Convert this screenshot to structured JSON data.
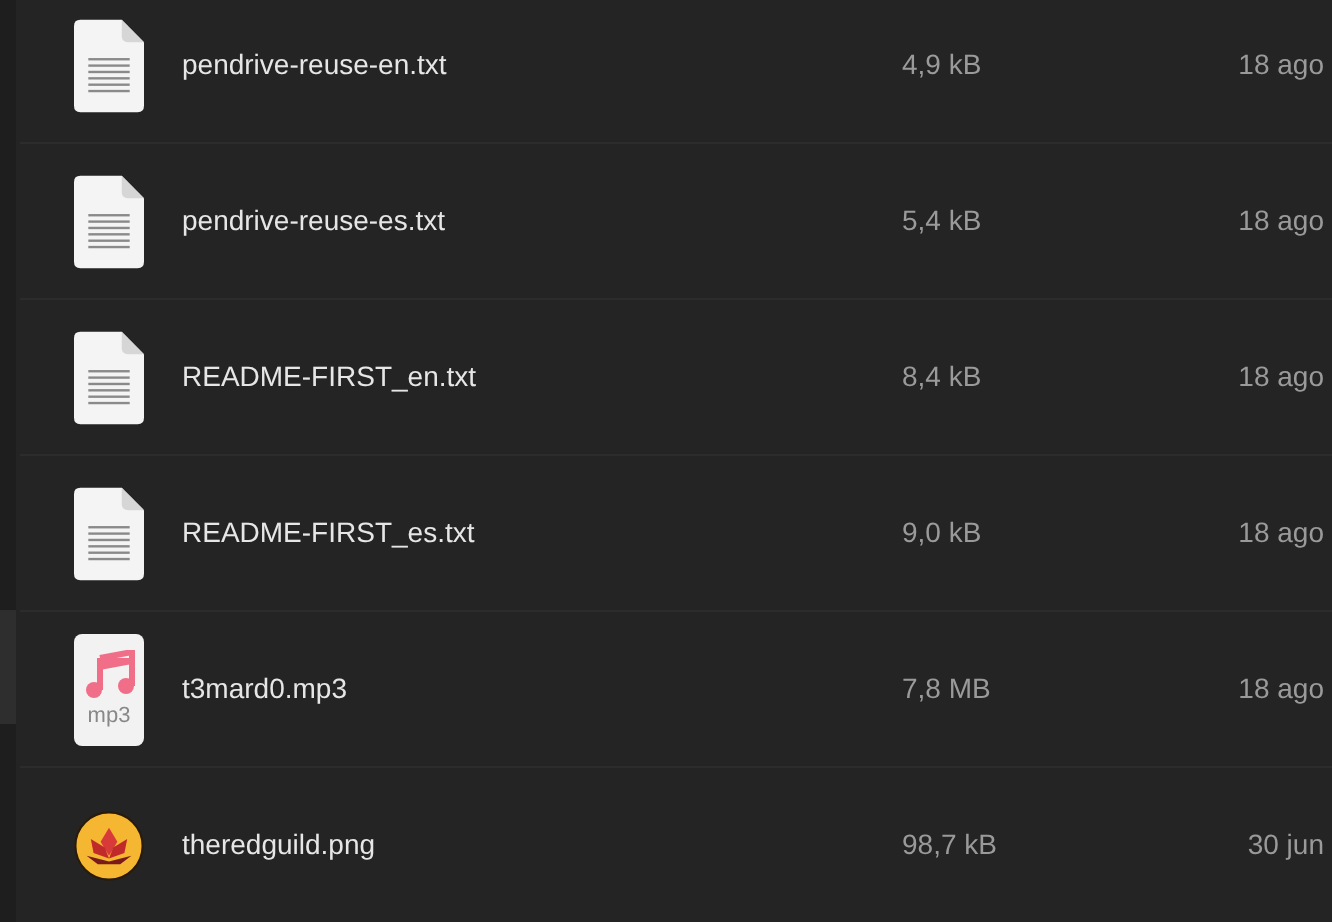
{
  "files": [
    {
      "name": "pendrive-reuse-en.txt",
      "size": "4,9 kB",
      "modified": "18 ago",
      "kind": "text"
    },
    {
      "name": "pendrive-reuse-es.txt",
      "size": "5,4 kB",
      "modified": "18 ago",
      "kind": "text"
    },
    {
      "name": "README-FIRST_en.txt",
      "size": "8,4 kB",
      "modified": "18 ago",
      "kind": "text"
    },
    {
      "name": "README-FIRST_es.txt",
      "size": "9,0 kB",
      "modified": "18 ago",
      "kind": "text"
    },
    {
      "name": "t3mard0.mp3",
      "size": "7,8 MB",
      "modified": "18 ago",
      "kind": "audio",
      "badge": "mp3"
    },
    {
      "name": "theredguild.png",
      "size": "98,7 kB",
      "modified": "30 jun"
    }
  ]
}
